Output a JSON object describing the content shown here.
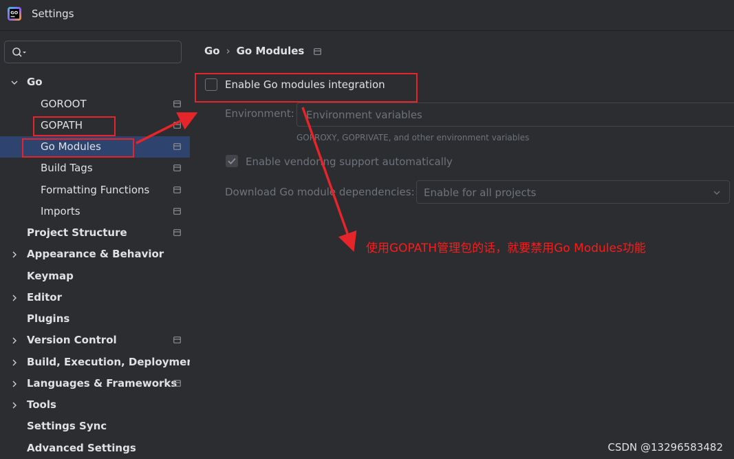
{
  "window": {
    "title": "Settings",
    "app_icon": "goland-icon"
  },
  "sidebar": {
    "search": {
      "value": "",
      "placeholder": ""
    },
    "items": [
      {
        "label": "Go",
        "expanded": true
      },
      {
        "label": "GOROOT"
      },
      {
        "label": "GOPATH"
      },
      {
        "label": "Go Modules",
        "selected": true
      },
      {
        "label": "Build Tags"
      },
      {
        "label": "Formatting Functions"
      },
      {
        "label": "Imports"
      },
      {
        "label": "Project Structure"
      },
      {
        "label": "Appearance & Behavior"
      },
      {
        "label": "Keymap"
      },
      {
        "label": "Editor"
      },
      {
        "label": "Plugins"
      },
      {
        "label": "Version Control"
      },
      {
        "label": "Build, Execution, Deployment"
      },
      {
        "label": "Languages & Frameworks"
      },
      {
        "label": "Tools"
      },
      {
        "label": "Settings Sync"
      },
      {
        "label": "Advanced Settings"
      }
    ]
  },
  "main": {
    "breadcrumb": [
      "Go",
      "Go Modules"
    ],
    "enable_modules": {
      "label": "Enable Go modules integration",
      "checked": false
    },
    "environment": {
      "label": "Environment:",
      "placeholder": "Environment variables",
      "hint": "GOPROXY, GOPRIVATE, and other environment variables"
    },
    "vendoring": {
      "label": "Enable vendoring support automatically",
      "checked": true,
      "disabled": true
    },
    "download_deps": {
      "label": "Download Go module dependencies:",
      "selected": "Enable for all projects"
    }
  },
  "annotation": {
    "text": "使用GOPATH管理包的话，就要禁用Go Modules功能"
  },
  "watermark": "CSDN @13296583482",
  "colors": {
    "background": "#2b2d30",
    "selection": "#2e436e",
    "annotation_red": "#e5252a",
    "text": "#dfe1e5",
    "disabled_text": "#6f737a"
  }
}
